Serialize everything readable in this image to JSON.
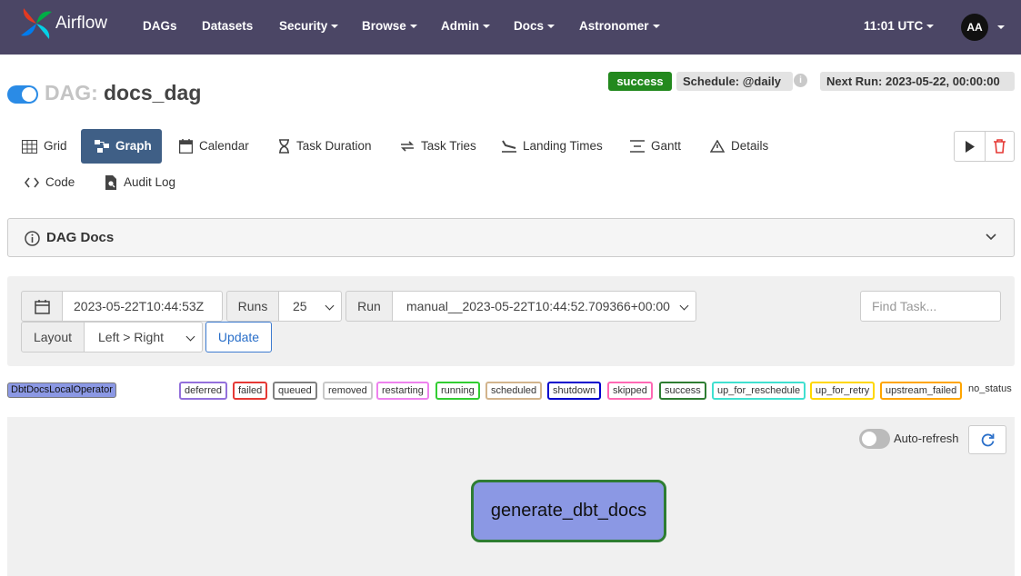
{
  "navbar": {
    "brand": "Airflow",
    "items": [
      {
        "label": "DAGs"
      },
      {
        "label": "Datasets"
      },
      {
        "label": "Security"
      },
      {
        "label": "Browse"
      },
      {
        "label": "Admin"
      },
      {
        "label": "Docs"
      },
      {
        "label": "Astronomer"
      }
    ],
    "time": "11:01 UTC",
    "avatar": "AA",
    "bg_color": "#4b4665"
  },
  "dag": {
    "prefix": "DAG:",
    "id": "docs_dag",
    "status": "success",
    "schedule": "Schedule: @daily",
    "next_run": "Next Run: 2023-05-22, 00:00:00",
    "paused_toggle_on": true
  },
  "tabs": [
    {
      "label": "Grid",
      "icon": "grid-icon"
    },
    {
      "label": "Graph",
      "icon": "graph-icon",
      "active": true
    },
    {
      "label": "Calendar",
      "icon": "calendar-icon"
    },
    {
      "label": "Task Duration",
      "icon": "hourglass-icon"
    },
    {
      "label": "Task Tries",
      "icon": "retry-icon"
    },
    {
      "label": "Landing Times",
      "icon": "plane-landing-icon"
    },
    {
      "label": "Gantt",
      "icon": "gantt-icon"
    },
    {
      "label": "Details",
      "icon": "warning-triangle-icon"
    },
    {
      "label": "Code",
      "icon": "code-icon"
    },
    {
      "label": "Audit Log",
      "icon": "audit-log-icon"
    }
  ],
  "docs": {
    "title": "DAG Docs"
  },
  "filters": {
    "date": "2023-05-22T10:44:53Z",
    "runs_label": "Runs",
    "runs_value": "25",
    "run_label": "Run",
    "run_value": "manual__2023-05-22T10:44:52.709366+00:00",
    "layout_label": "Layout",
    "layout_value": "Left > Right",
    "update_label": "Update",
    "find_task_placeholder": "Find Task..."
  },
  "legend": {
    "operator": "DbtDocsLocalOperator",
    "states": [
      {
        "label": "deferred",
        "color": "#9370db"
      },
      {
        "label": "failed",
        "color": "#e53935"
      },
      {
        "label": "queued",
        "color": "#808080"
      },
      {
        "label": "removed",
        "color": "#c8c8c8"
      },
      {
        "label": "restarting",
        "color": "#ee82ee"
      },
      {
        "label": "running",
        "color": "#32cd32"
      },
      {
        "label": "scheduled",
        "color": "#d2b48c"
      },
      {
        "label": "shutdown",
        "color": "#0000cc"
      },
      {
        "label": "skipped",
        "color": "#ff69b4"
      },
      {
        "label": "success",
        "color": "#2e7d32"
      },
      {
        "label": "up_for_reschedule",
        "color": "#40e0d0"
      },
      {
        "label": "up_for_retry",
        "color": "#ffd700"
      },
      {
        "label": "upstream_failed",
        "color": "#ffa500"
      }
    ],
    "no_status": "no_status"
  },
  "graph": {
    "auto_refresh_label": "Auto-refresh",
    "auto_refresh_on": false,
    "task": "generate_dbt_docs"
  }
}
